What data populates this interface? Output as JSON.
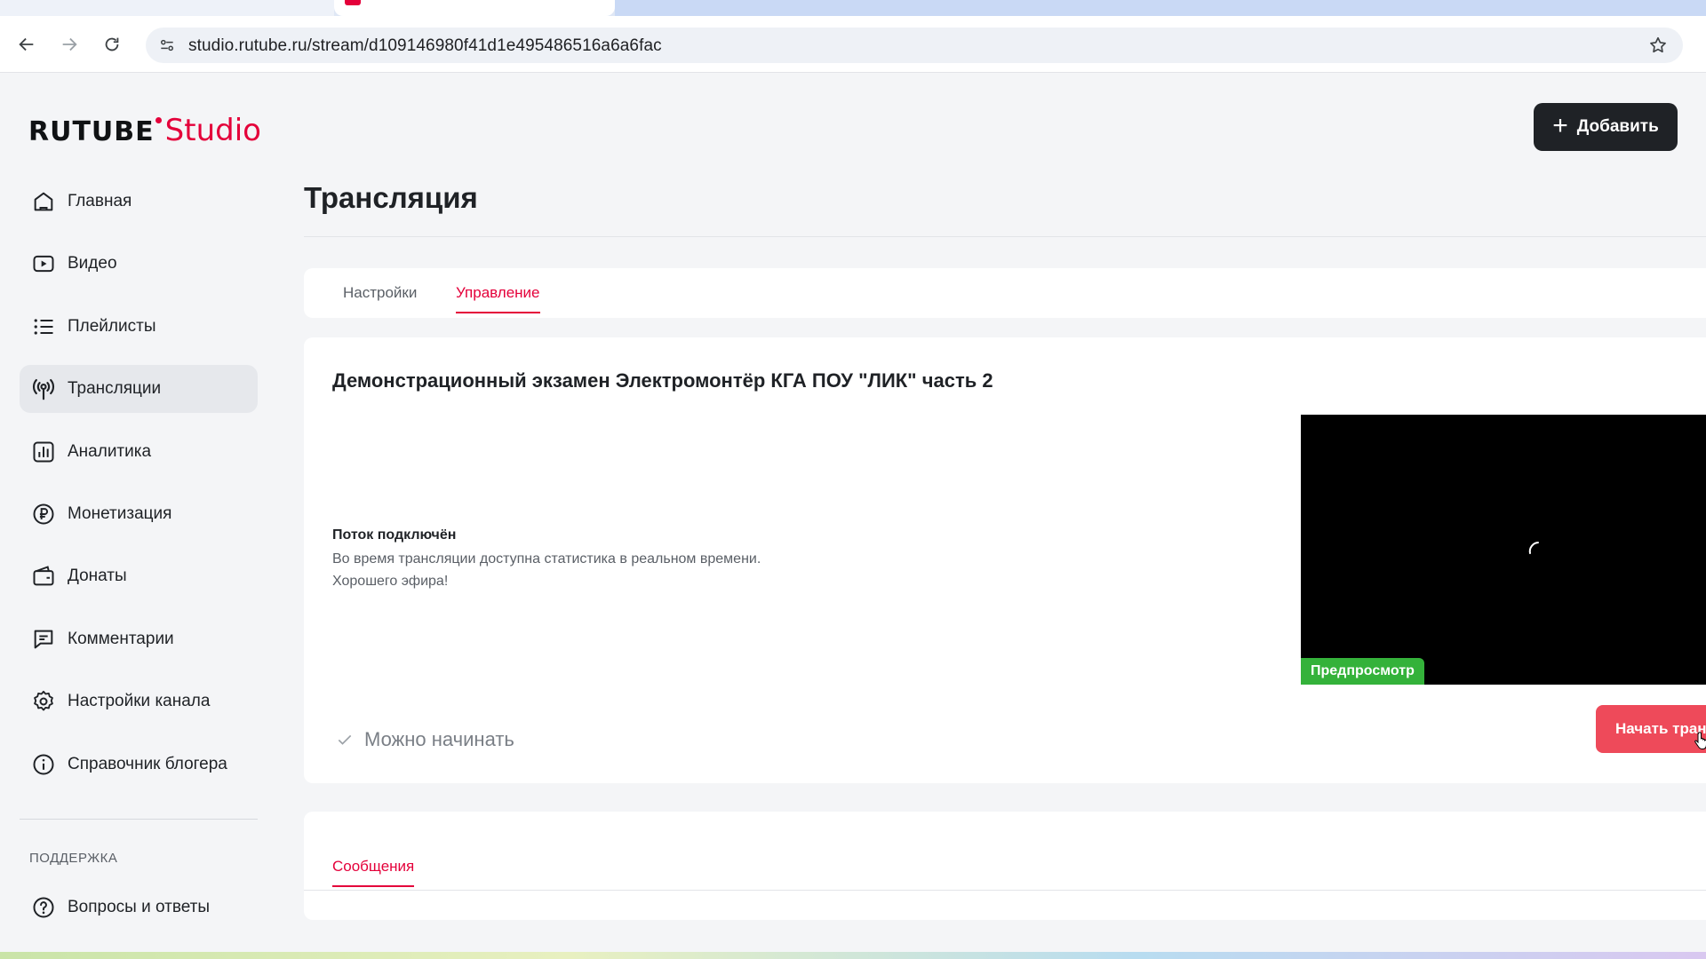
{
  "browser": {
    "url": "studio.rutube.ru/stream/d109146980f41d1e495486516a6a6fac"
  },
  "header": {
    "logo_primary": "RUTUBE",
    "logo_secondary": "Studio",
    "add_label": "Добавить"
  },
  "sidebar": {
    "items": [
      {
        "label": "Главная",
        "icon": "home-icon"
      },
      {
        "label": "Видео",
        "icon": "video-icon"
      },
      {
        "label": "Плейлисты",
        "icon": "list-icon"
      },
      {
        "label": "Трансляции",
        "icon": "broadcast-icon",
        "active": true
      },
      {
        "label": "Аналитика",
        "icon": "analytics-icon"
      },
      {
        "label": "Монетизация",
        "icon": "ruble-icon"
      },
      {
        "label": "Донаты",
        "icon": "wallet-icon"
      },
      {
        "label": "Комментарии",
        "icon": "comment-icon"
      },
      {
        "label": "Настройки канала",
        "icon": "gear-icon"
      },
      {
        "label": "Справочник блогера",
        "icon": "info-icon"
      }
    ],
    "support_title": "ПОДДЕРЖКА",
    "support_items": [
      {
        "label": "Вопросы и ответы",
        "icon": "question-icon"
      }
    ]
  },
  "main": {
    "page_title": "Трансляция",
    "tabs": [
      {
        "label": "Настройки"
      },
      {
        "label": "Управление",
        "active": true
      }
    ],
    "stream": {
      "title": "Демонстрационный экзамен Электромонтёр КГА ПОУ \"ЛИК\" часть 2",
      "status_title": "Поток подключён",
      "status_line1": "Во время трансляции доступна статистика в реальном времени.",
      "status_line2": "Хорошего эфира!",
      "ready_label": "Можно начинать",
      "preview_label": "Предпросмотр",
      "start_label": "Начать трансляцию"
    },
    "messages_tab": "Сообщения"
  },
  "colors": {
    "accent": "#e4003a",
    "preview_badge": "#34b23a",
    "start_button": "#ee4a5a",
    "dark_button": "#1f2226"
  }
}
